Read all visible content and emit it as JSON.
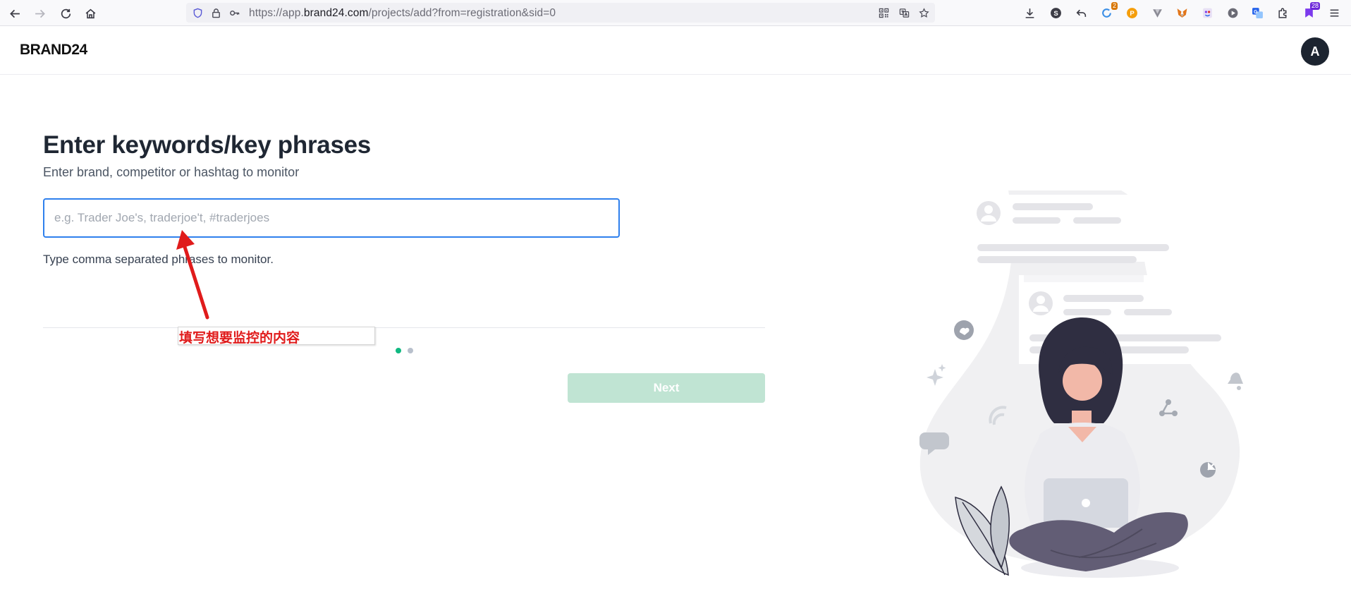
{
  "browser": {
    "url_prefix": "https://app.",
    "url_domain": "brand24.com",
    "url_path": "/projects/add?from=registration&sid=0",
    "badges": {
      "notifications": "2",
      "bookmarks": "28"
    }
  },
  "header": {
    "logo": "BRAND24",
    "avatar_initial": "A"
  },
  "form": {
    "title": "Enter keywords/key phrases",
    "subtitle": "Enter brand, competitor or hashtag to monitor",
    "input_placeholder": "e.g. Trader Joe's, traderjoe't, #traderjoes",
    "input_value": "",
    "hint": "Type comma separated phrases to monitor.",
    "next_label": "Next",
    "steps": {
      "current": 1,
      "total": 2
    }
  },
  "annotation": {
    "text": "填写想要监控的内容"
  },
  "colors": {
    "input_border": "#2f80ed",
    "next_disabled": "#c0e4d3",
    "step_active": "#10b981",
    "step_inactive": "#b8c0cc",
    "annotation": "#e01b1b"
  }
}
